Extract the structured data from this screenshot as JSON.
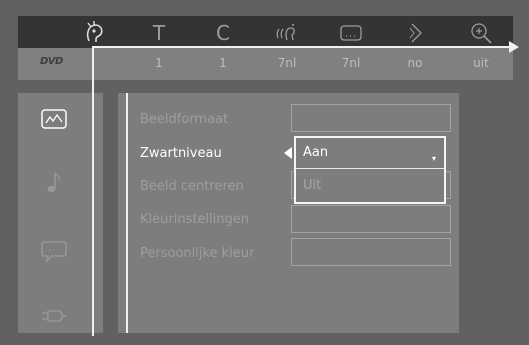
{
  "top_menu": {
    "disc_logo": "DVD",
    "items": [
      {
        "icon": "disc-menu-icon",
        "value": ""
      },
      {
        "icon": "title-icon",
        "value": "1"
      },
      {
        "icon": "chapter-icon",
        "value": "1"
      },
      {
        "icon": "audio-language-icon",
        "value": "7nl"
      },
      {
        "icon": "subtitle-icon",
        "value": "7nl"
      },
      {
        "icon": "angle-icon",
        "value": "no"
      },
      {
        "icon": "zoom-icon",
        "value": "uit"
      }
    ],
    "glyphs": {
      "title": "T",
      "chapter": "C"
    }
  },
  "side_menu": {
    "items": [
      {
        "icon": "picture-settings-icon",
        "selected": true
      },
      {
        "icon": "music-note-icon",
        "selected": false
      },
      {
        "icon": "speech-bubble-icon",
        "selected": false
      },
      {
        "icon": "plug-icon",
        "selected": false
      }
    ]
  },
  "settings": {
    "rows": [
      {
        "label": "Beeldformaat",
        "active": false
      },
      {
        "label": "Zwartniveau",
        "active": true
      },
      {
        "label": "Beeld centreren",
        "active": false
      },
      {
        "label": "Kleurinstellingen",
        "active": false
      },
      {
        "label": "Persoonlijke kleur",
        "active": false
      }
    ]
  },
  "dropdown": {
    "options": [
      "Aan",
      "Uit"
    ],
    "selected": "Aan",
    "caret": "▾"
  },
  "colors": {
    "background": "#616161",
    "panel": "#7d7d7d",
    "highlight": "#ffffff",
    "dim_text": "#9e9e9e"
  }
}
